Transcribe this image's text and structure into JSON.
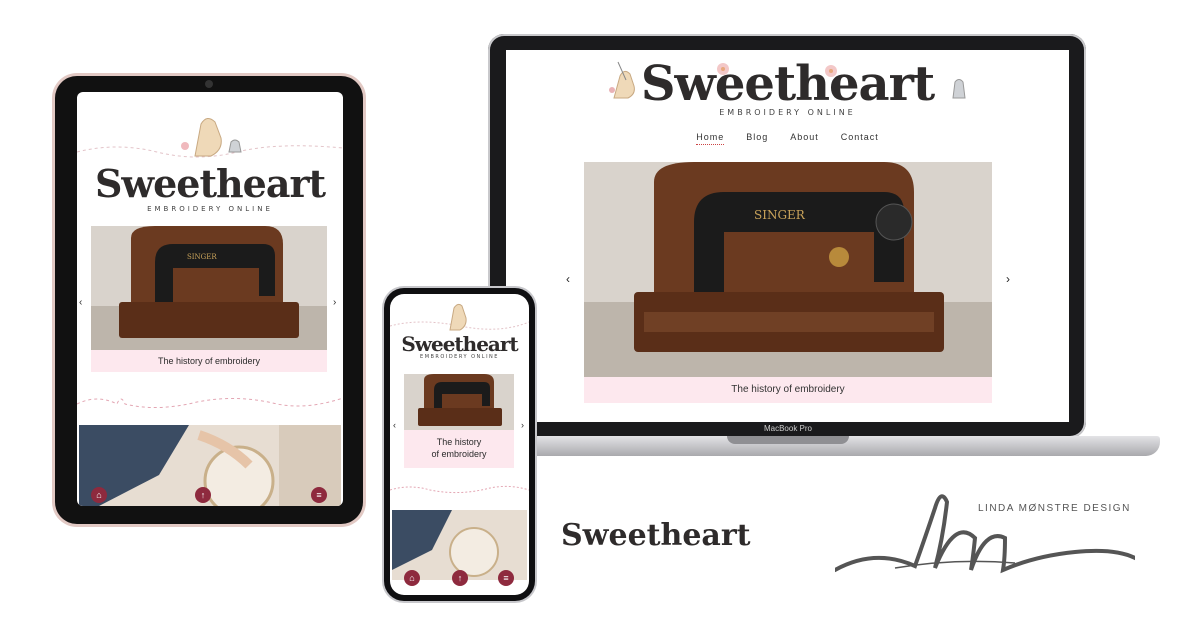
{
  "site": {
    "name": "Sweetheart",
    "tagline": "EMBROIDERY ONLINE",
    "nav": [
      "Home",
      "Blog",
      "About",
      "Contact"
    ],
    "hero_caption": "The history of embroidery",
    "hero_caption_phone_line1": "The history",
    "hero_caption_phone_line2": "of embroidery",
    "prev_arrow": "‹",
    "next_arrow": "›"
  },
  "laptop": {
    "brand": "MacBook Pro"
  },
  "bottom_bar": {
    "home_icon": "home-icon",
    "up_icon": "arrow-up-icon",
    "menu_icon": "menu-icon"
  },
  "brand_title": "Sweetheart",
  "designer": {
    "monogram": "lm",
    "name": "LINDA MØNSTRE DESIGN"
  },
  "colors": {
    "accent": "#8e2a3e",
    "caption_bg": "#fde8ee",
    "logo": "#2e2b2b"
  }
}
